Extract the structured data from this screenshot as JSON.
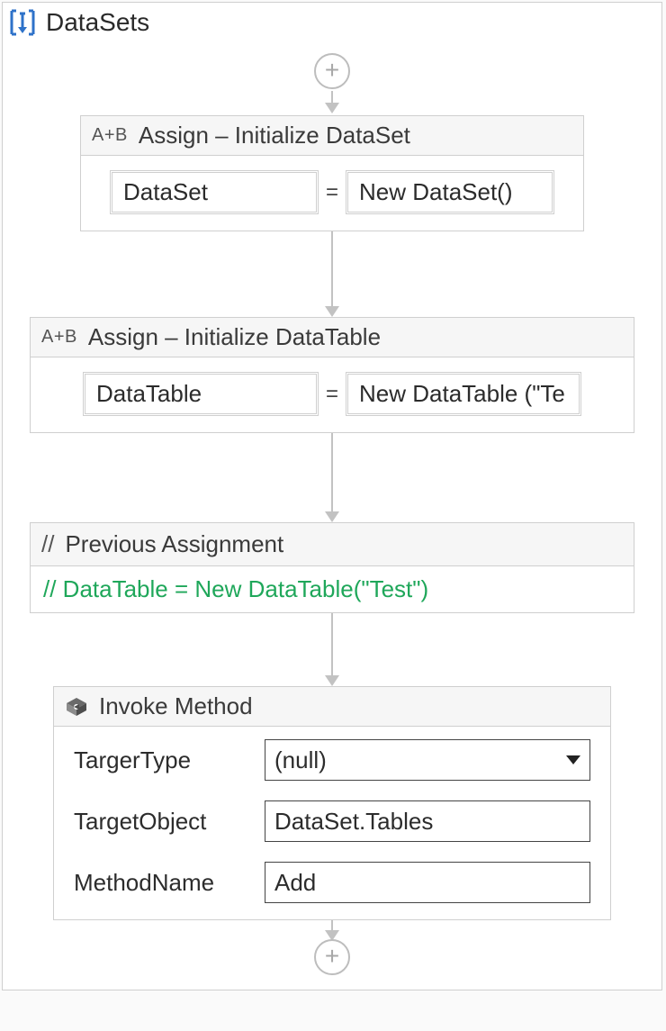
{
  "workflow": {
    "title": "DataSets"
  },
  "activities": {
    "assign1": {
      "badge": "A+B",
      "title": "Assign – Initialize DataSet",
      "left": "DataSet",
      "eq": "=",
      "right": "New DataSet()"
    },
    "assign2": {
      "badge": "A+B",
      "title": "Assign – Initialize DataTable",
      "left": "DataTable",
      "eq": "=",
      "right": "New DataTable (\"Te"
    },
    "comment": {
      "badge": "//",
      "title": "Previous Assignment",
      "body": "// DataTable = New DataTable(\"Test\")"
    },
    "invoke": {
      "title": "Invoke Method",
      "fields": {
        "targetTypeLabel": "TargerType",
        "targetTypeValue": "(null)",
        "targetObjectLabel": "TargetObject",
        "targetObjectValue": "DataSet.Tables",
        "methodNameLabel": "MethodName",
        "methodNameValue": "Add"
      }
    }
  },
  "glyphs": {
    "plus": "+"
  }
}
